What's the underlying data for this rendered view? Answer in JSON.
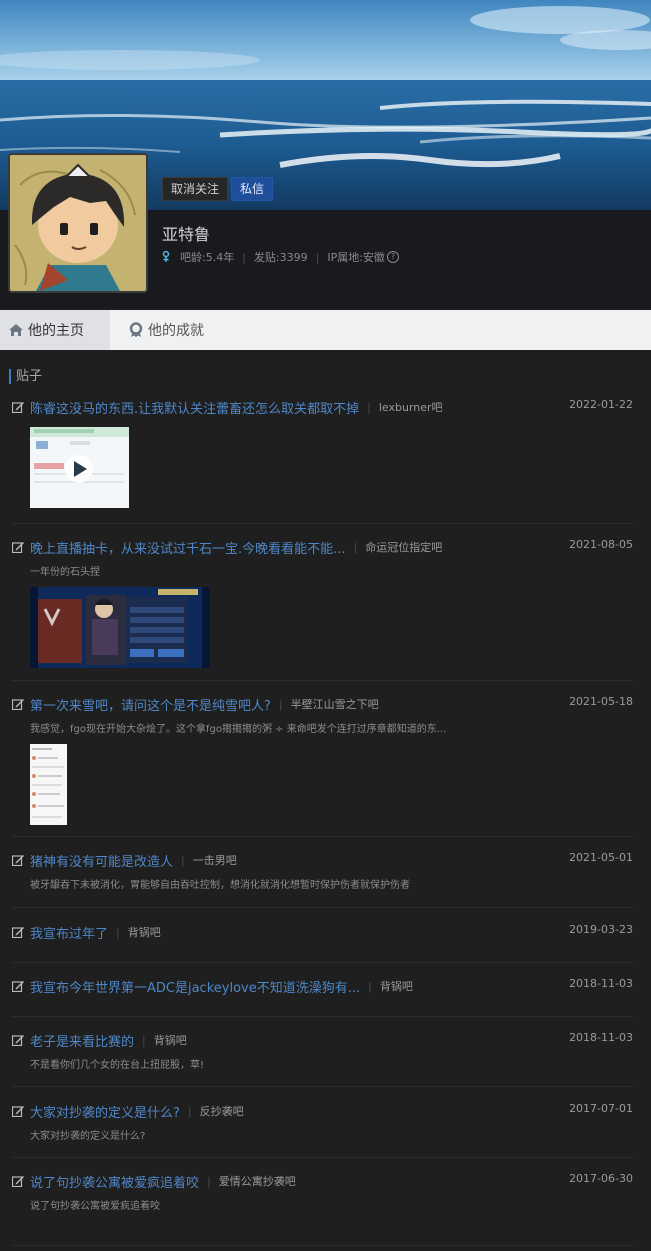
{
  "profile": {
    "unfollow_label": "取消关注",
    "message_label": "私信",
    "username": "亚特鲁",
    "bar_age": "吧龄:5.4年",
    "post_count": "发贴:3399",
    "ip_location": "IP属地:安徽",
    "help_glyph": "?"
  },
  "tabs": [
    {
      "label": "他的主页",
      "icon": "home-icon"
    },
    {
      "label": "他的成就",
      "icon": "achievement-icon"
    }
  ],
  "section_title": "贴子",
  "posts": [
    {
      "title": "陈睿这没马的东西.让我默认关注蕾畜还怎么取关都取不掉",
      "forum": "lexburner吧",
      "date": "2022-01-22",
      "excerpt": "",
      "thumbnail": "video-screenshot"
    },
    {
      "title": "晚上直播抽卡，从来没试过千石一宝.今晚看看能不能...",
      "forum": "命运冠位指定吧",
      "date": "2021-08-05",
      "excerpt": "一年份的石头捏",
      "thumbnail": "game-screenshot"
    },
    {
      "title": "第一次来雪吧，请问这个是不是纯雪吧人?",
      "forum": "半壁江山雪之下吧",
      "date": "2021-05-18",
      "excerpt": "我感觉，fgo现在开始大杂烩了。这个拿fgo搊搊搊的粥 ÷ 来命吧发个连打过序章都知道的东...",
      "thumbnail": "phone-screenshot"
    },
    {
      "title": "猪神有没有可能是改造人",
      "forum": "一击男吧",
      "date": "2021-05-01",
      "excerpt": "被牙龈吞下未被消化，胃能够自由吞吐控制，想消化就消化想暂时保护伤者就保护伤者"
    },
    {
      "title": "我宣布过年了",
      "forum": "背锅吧",
      "date": "2019-03-23",
      "excerpt": ""
    },
    {
      "title": "我宣布今年世界第一ADC是jackeylove不知道洗澡狗有...",
      "forum": "背锅吧",
      "date": "2018-11-03",
      "excerpt": ""
    },
    {
      "title": "老子是来看比赛的",
      "forum": "背锅吧",
      "date": "2018-11-03",
      "excerpt": "不是看你们几个女的在台上扭屁股，草!"
    },
    {
      "title": "大家对抄袭的定义是什么?",
      "forum": "反抄袭吧",
      "date": "2017-07-01",
      "excerpt": "大家对抄袭的定义是什么?"
    },
    {
      "title": "说了句抄袭公寓被爱疯追着咬",
      "forum": "爱情公寓抄袭吧",
      "date": "2017-06-30",
      "excerpt": "说了句抄袭公寓被爱疯追着咬"
    }
  ]
}
